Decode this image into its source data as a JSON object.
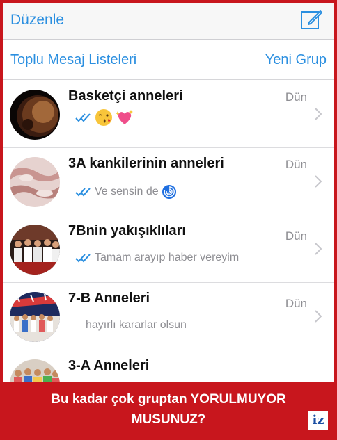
{
  "nav": {
    "edit_label": "Düzenle",
    "compose_icon": "compose-icon"
  },
  "subbar": {
    "broadcast_label": "Toplu Mesaj Listeleri",
    "new_group_label": "Yeni Grup"
  },
  "chats": [
    {
      "name": "Basketçi anneleri",
      "time": "Dün",
      "preview": "",
      "read_ticks": true,
      "emojis": [
        "kissing-face-emoji",
        "sparkling-heart-emoji"
      ]
    },
    {
      "name": "3A kankilerinin anneleri",
      "time": "Dün",
      "preview": "Ve sensin de",
      "read_ticks": true,
      "emojis": [
        "cyclone-emoji"
      ]
    },
    {
      "name": "7Bnin yakışıklıları",
      "time": "Dün",
      "preview": "Tamam arayıp haber vereyim",
      "read_ticks": true,
      "emojis": []
    },
    {
      "name": "7-B Anneleri",
      "time": "Dün",
      "preview": "hayırlı kararlar olsun",
      "read_ticks": false,
      "emojis": []
    },
    {
      "name": "3-A Anneleri",
      "time": "",
      "preview": "",
      "read_ticks": false,
      "emojis": []
    }
  ],
  "banner": {
    "line1": "Bu kadar çok gruptan YORULMUYOR",
    "line2": "MUSUNUZ?",
    "logo": "iz"
  },
  "colors": {
    "accent": "#2b8fe0",
    "banner": "#c8161d",
    "time_gray": "#8e8e93"
  }
}
